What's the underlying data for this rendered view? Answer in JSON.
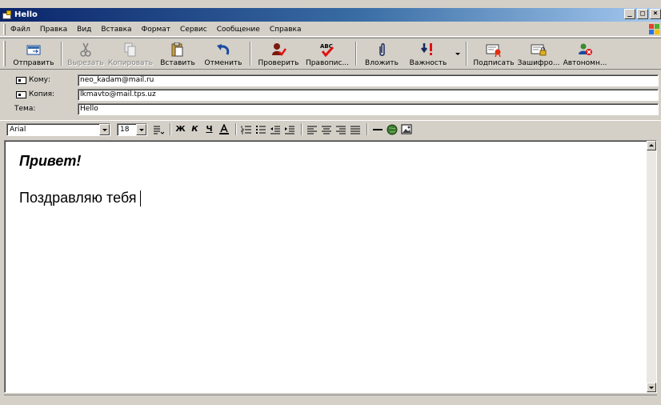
{
  "window": {
    "title": "Hello",
    "buttons": [
      "_",
      "□",
      "×"
    ]
  },
  "menu": {
    "items": [
      "Файл",
      "Правка",
      "Вид",
      "Вставка",
      "Формат",
      "Сервис",
      "Сообщение",
      "Справка"
    ]
  },
  "toolbar": {
    "buttons": [
      {
        "label": "Отправить",
        "icon": "send-icon"
      },
      {
        "label": "Вырезать",
        "icon": "scissors-icon"
      },
      {
        "label": "Копировать",
        "icon": "copy-icon"
      },
      {
        "label": "Вставить",
        "icon": "paste-icon"
      },
      {
        "label": "Отменить",
        "icon": "undo-icon"
      },
      {
        "label": "Проверить",
        "icon": "check-names-icon"
      },
      {
        "label": "Правопис...",
        "icon": "spelling-icon"
      },
      {
        "label": "Вложить",
        "icon": "paperclip-icon"
      },
      {
        "label": "Важность",
        "icon": "priority-icon"
      },
      {
        "label": "Подписать",
        "icon": "sign-icon"
      },
      {
        "label": "Зашифро...",
        "icon": "encrypt-icon"
      },
      {
        "label": "Автономн...",
        "icon": "offline-icon"
      }
    ]
  },
  "header": {
    "to_label": "Кому:",
    "to_value": "neo_kadam@mail.ru",
    "cc_label": "Копия:",
    "cc_value": "lkmavto@mail.tps.uz",
    "subject_label": "Тема:",
    "subject_value": "Hello"
  },
  "format": {
    "font": "Arial",
    "size": "18"
  },
  "message": {
    "greeting": "Привет!",
    "line1": "Поздравляю тебя"
  },
  "colors": {
    "titlebar_start": "#0a246a",
    "titlebar_end": "#a6caf0",
    "face": "#d4d0c8"
  }
}
